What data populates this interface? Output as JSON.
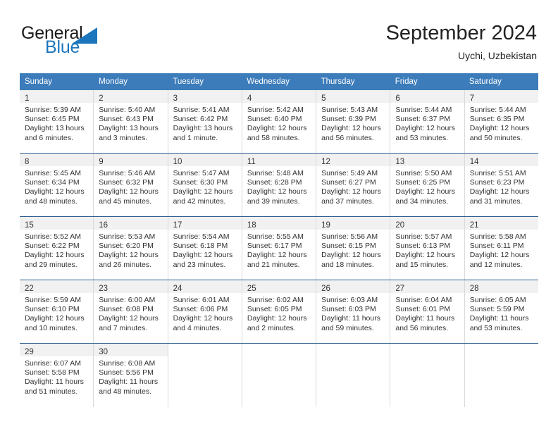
{
  "brand": {
    "name_top": "General",
    "name_bottom": "Blue",
    "accent_color": "#1c76bc",
    "triangle_icon": "triangle-logo-icon"
  },
  "header": {
    "title": "September 2024",
    "subtitle": "Uychi, Uzbekistan"
  },
  "theme": {
    "header_row_bg": "#3c7cba",
    "header_row_text": "#ffffff",
    "row_divider": "#2e5f8f",
    "daynum_band_bg": "#f1f1f1",
    "cell_border": "#d9d9d9",
    "text_color": "#333333"
  },
  "calendar": {
    "weekday_headers": [
      "Sunday",
      "Monday",
      "Tuesday",
      "Wednesday",
      "Thursday",
      "Friday",
      "Saturday"
    ],
    "weeks": [
      [
        {
          "day": "1",
          "sunrise": "Sunrise: 5:39 AM",
          "sunset": "Sunset: 6:45 PM",
          "daylight_1": "Daylight: 13 hours",
          "daylight_2": "and 6 minutes."
        },
        {
          "day": "2",
          "sunrise": "Sunrise: 5:40 AM",
          "sunset": "Sunset: 6:43 PM",
          "daylight_1": "Daylight: 13 hours",
          "daylight_2": "and 3 minutes."
        },
        {
          "day": "3",
          "sunrise": "Sunrise: 5:41 AM",
          "sunset": "Sunset: 6:42 PM",
          "daylight_1": "Daylight: 13 hours",
          "daylight_2": "and 1 minute."
        },
        {
          "day": "4",
          "sunrise": "Sunrise: 5:42 AM",
          "sunset": "Sunset: 6:40 PM",
          "daylight_1": "Daylight: 12 hours",
          "daylight_2": "and 58 minutes."
        },
        {
          "day": "5",
          "sunrise": "Sunrise: 5:43 AM",
          "sunset": "Sunset: 6:39 PM",
          "daylight_1": "Daylight: 12 hours",
          "daylight_2": "and 56 minutes."
        },
        {
          "day": "6",
          "sunrise": "Sunrise: 5:44 AM",
          "sunset": "Sunset: 6:37 PM",
          "daylight_1": "Daylight: 12 hours",
          "daylight_2": "and 53 minutes."
        },
        {
          "day": "7",
          "sunrise": "Sunrise: 5:44 AM",
          "sunset": "Sunset: 6:35 PM",
          "daylight_1": "Daylight: 12 hours",
          "daylight_2": "and 50 minutes."
        }
      ],
      [
        {
          "day": "8",
          "sunrise": "Sunrise: 5:45 AM",
          "sunset": "Sunset: 6:34 PM",
          "daylight_1": "Daylight: 12 hours",
          "daylight_2": "and 48 minutes."
        },
        {
          "day": "9",
          "sunrise": "Sunrise: 5:46 AM",
          "sunset": "Sunset: 6:32 PM",
          "daylight_1": "Daylight: 12 hours",
          "daylight_2": "and 45 minutes."
        },
        {
          "day": "10",
          "sunrise": "Sunrise: 5:47 AM",
          "sunset": "Sunset: 6:30 PM",
          "daylight_1": "Daylight: 12 hours",
          "daylight_2": "and 42 minutes."
        },
        {
          "day": "11",
          "sunrise": "Sunrise: 5:48 AM",
          "sunset": "Sunset: 6:28 PM",
          "daylight_1": "Daylight: 12 hours",
          "daylight_2": "and 39 minutes."
        },
        {
          "day": "12",
          "sunrise": "Sunrise: 5:49 AM",
          "sunset": "Sunset: 6:27 PM",
          "daylight_1": "Daylight: 12 hours",
          "daylight_2": "and 37 minutes."
        },
        {
          "day": "13",
          "sunrise": "Sunrise: 5:50 AM",
          "sunset": "Sunset: 6:25 PM",
          "daylight_1": "Daylight: 12 hours",
          "daylight_2": "and 34 minutes."
        },
        {
          "day": "14",
          "sunrise": "Sunrise: 5:51 AM",
          "sunset": "Sunset: 6:23 PM",
          "daylight_1": "Daylight: 12 hours",
          "daylight_2": "and 31 minutes."
        }
      ],
      [
        {
          "day": "15",
          "sunrise": "Sunrise: 5:52 AM",
          "sunset": "Sunset: 6:22 PM",
          "daylight_1": "Daylight: 12 hours",
          "daylight_2": "and 29 minutes."
        },
        {
          "day": "16",
          "sunrise": "Sunrise: 5:53 AM",
          "sunset": "Sunset: 6:20 PM",
          "daylight_1": "Daylight: 12 hours",
          "daylight_2": "and 26 minutes."
        },
        {
          "day": "17",
          "sunrise": "Sunrise: 5:54 AM",
          "sunset": "Sunset: 6:18 PM",
          "daylight_1": "Daylight: 12 hours",
          "daylight_2": "and 23 minutes."
        },
        {
          "day": "18",
          "sunrise": "Sunrise: 5:55 AM",
          "sunset": "Sunset: 6:17 PM",
          "daylight_1": "Daylight: 12 hours",
          "daylight_2": "and 21 minutes."
        },
        {
          "day": "19",
          "sunrise": "Sunrise: 5:56 AM",
          "sunset": "Sunset: 6:15 PM",
          "daylight_1": "Daylight: 12 hours",
          "daylight_2": "and 18 minutes."
        },
        {
          "day": "20",
          "sunrise": "Sunrise: 5:57 AM",
          "sunset": "Sunset: 6:13 PM",
          "daylight_1": "Daylight: 12 hours",
          "daylight_2": "and 15 minutes."
        },
        {
          "day": "21",
          "sunrise": "Sunrise: 5:58 AM",
          "sunset": "Sunset: 6:11 PM",
          "daylight_1": "Daylight: 12 hours",
          "daylight_2": "and 12 minutes."
        }
      ],
      [
        {
          "day": "22",
          "sunrise": "Sunrise: 5:59 AM",
          "sunset": "Sunset: 6:10 PM",
          "daylight_1": "Daylight: 12 hours",
          "daylight_2": "and 10 minutes."
        },
        {
          "day": "23",
          "sunrise": "Sunrise: 6:00 AM",
          "sunset": "Sunset: 6:08 PM",
          "daylight_1": "Daylight: 12 hours",
          "daylight_2": "and 7 minutes."
        },
        {
          "day": "24",
          "sunrise": "Sunrise: 6:01 AM",
          "sunset": "Sunset: 6:06 PM",
          "daylight_1": "Daylight: 12 hours",
          "daylight_2": "and 4 minutes."
        },
        {
          "day": "25",
          "sunrise": "Sunrise: 6:02 AM",
          "sunset": "Sunset: 6:05 PM",
          "daylight_1": "Daylight: 12 hours",
          "daylight_2": "and 2 minutes."
        },
        {
          "day": "26",
          "sunrise": "Sunrise: 6:03 AM",
          "sunset": "Sunset: 6:03 PM",
          "daylight_1": "Daylight: 11 hours",
          "daylight_2": "and 59 minutes."
        },
        {
          "day": "27",
          "sunrise": "Sunrise: 6:04 AM",
          "sunset": "Sunset: 6:01 PM",
          "daylight_1": "Daylight: 11 hours",
          "daylight_2": "and 56 minutes."
        },
        {
          "day": "28",
          "sunrise": "Sunrise: 6:05 AM",
          "sunset": "Sunset: 5:59 PM",
          "daylight_1": "Daylight: 11 hours",
          "daylight_2": "and 53 minutes."
        }
      ],
      [
        {
          "day": "29",
          "sunrise": "Sunrise: 6:07 AM",
          "sunset": "Sunset: 5:58 PM",
          "daylight_1": "Daylight: 11 hours",
          "daylight_2": "and 51 minutes."
        },
        {
          "day": "30",
          "sunrise": "Sunrise: 6:08 AM",
          "sunset": "Sunset: 5:56 PM",
          "daylight_1": "Daylight: 11 hours",
          "daylight_2": "and 48 minutes."
        },
        {
          "day": "",
          "sunrise": "",
          "sunset": "",
          "daylight_1": "",
          "daylight_2": ""
        },
        {
          "day": "",
          "sunrise": "",
          "sunset": "",
          "daylight_1": "",
          "daylight_2": ""
        },
        {
          "day": "",
          "sunrise": "",
          "sunset": "",
          "daylight_1": "",
          "daylight_2": ""
        },
        {
          "day": "",
          "sunrise": "",
          "sunset": "",
          "daylight_1": "",
          "daylight_2": ""
        },
        {
          "day": "",
          "sunrise": "",
          "sunset": "",
          "daylight_1": "",
          "daylight_2": ""
        }
      ]
    ]
  }
}
